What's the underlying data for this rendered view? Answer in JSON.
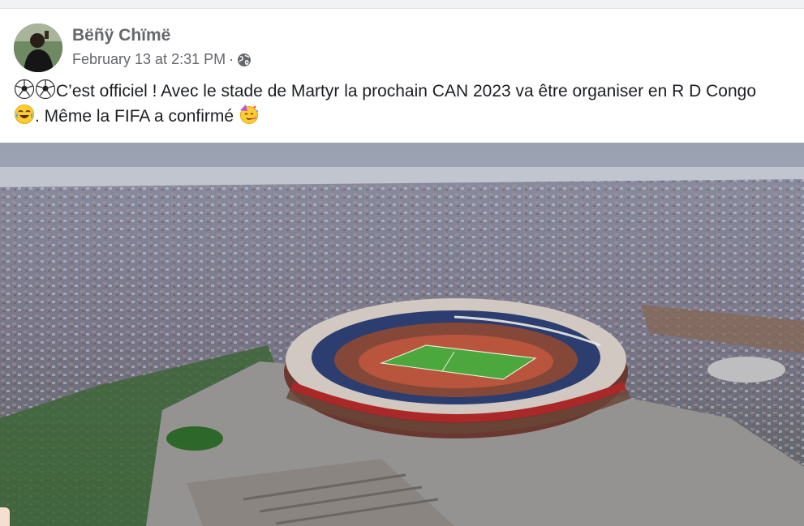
{
  "post": {
    "author": "Bëñÿ Chïmë",
    "timestamp": "February 13 at 2:31 PM",
    "separator": "·",
    "audience_icon": "globe-icon",
    "text_part1": "C’est officiel ! Avec le stade de Martyr la prochain CAN 2023 va être organiser en R D Congo",
    "text_part2": ". Même la FIFA a confirmé",
    "emojis": [
      "soccer-ball-icon",
      "soccer-ball-icon",
      "tears-of-joy-icon",
      "partying-face-icon"
    ],
    "image_subject": "aerial view of stadium in city"
  },
  "colors": {
    "page_bg": "#f0f2f5",
    "card_bg": "#ffffff",
    "author": "#65676b",
    "meta": "#65676b",
    "text": "#1c1e21",
    "pitch": "#4fae3e"
  }
}
